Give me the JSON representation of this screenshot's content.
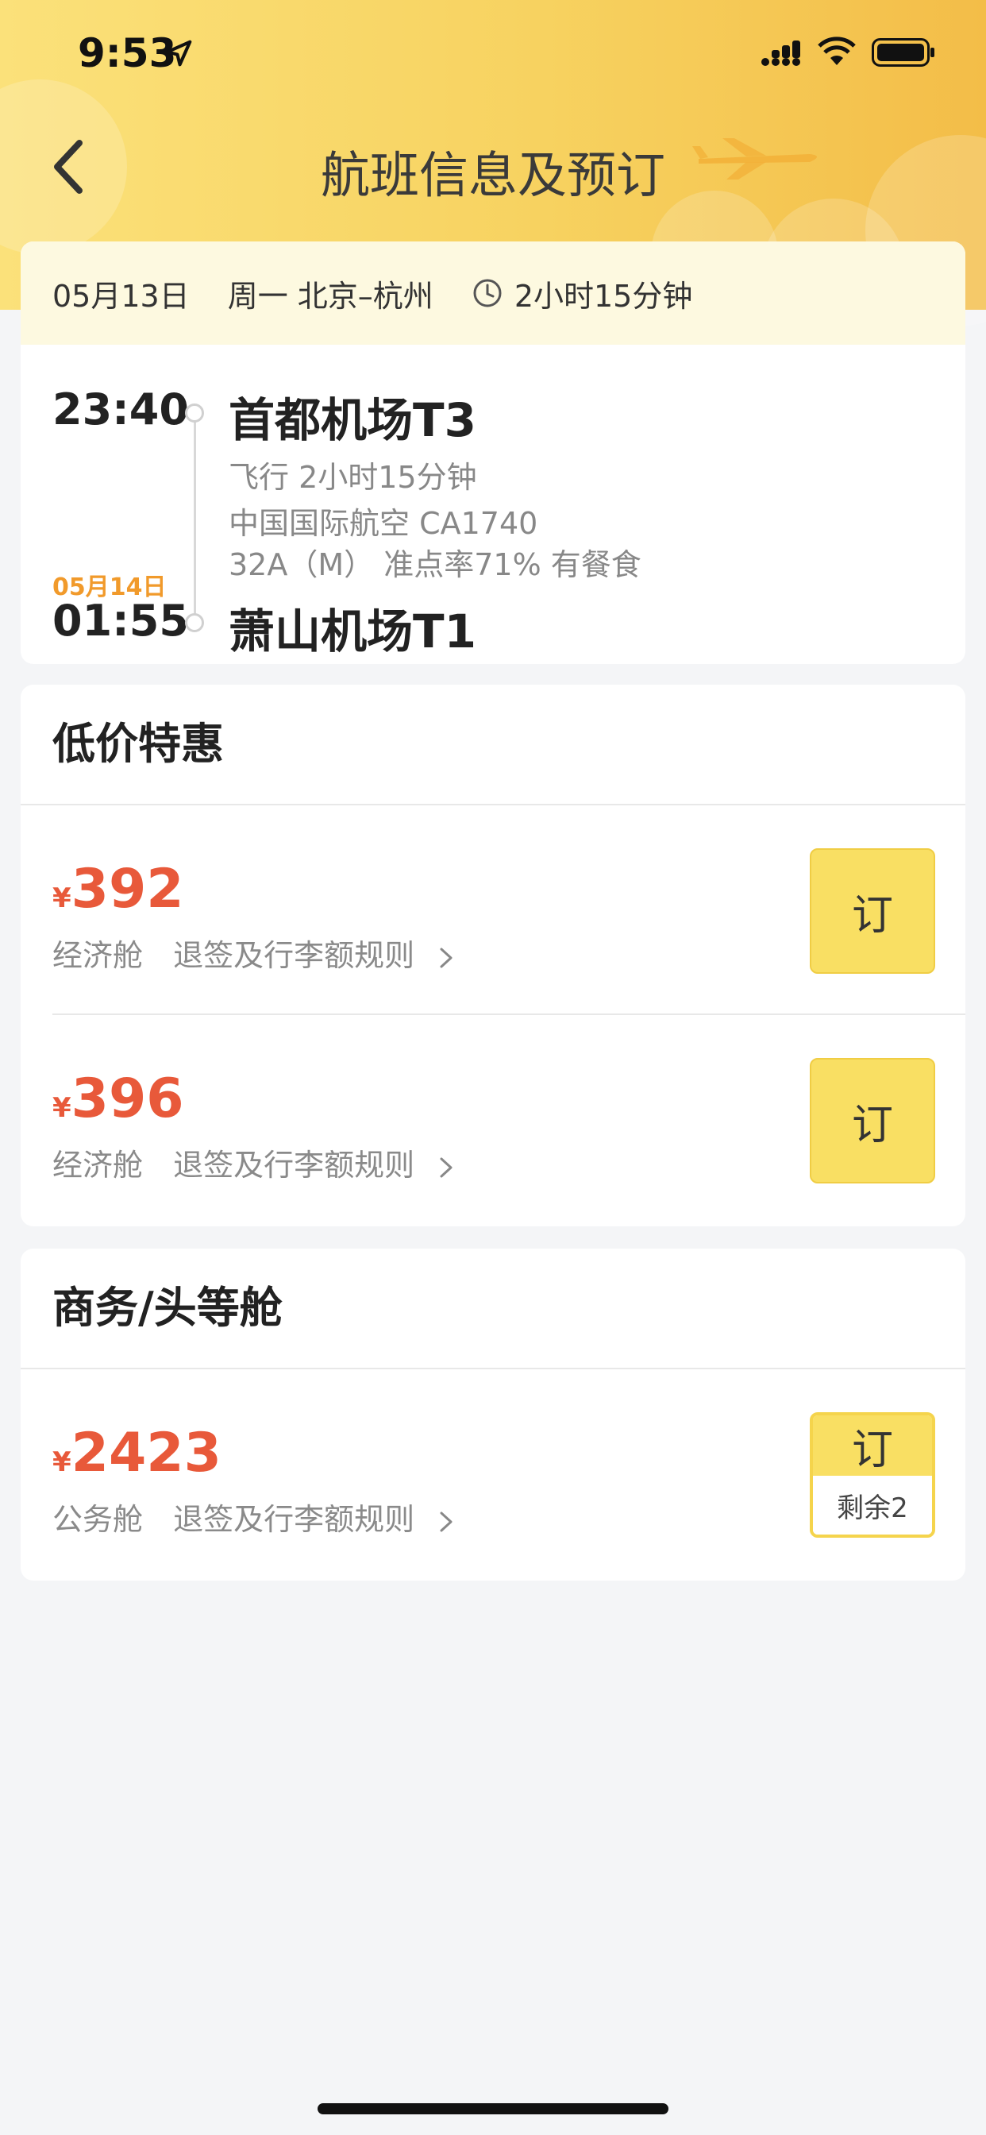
{
  "status_bar": {
    "time": "9:53",
    "icons": [
      "location-arrow-icon",
      "signal-icon",
      "wifi-icon",
      "battery-icon"
    ]
  },
  "nav": {
    "title": "航班信息及预订",
    "back_icon": "back-chevron-icon",
    "decor_icon": "airplane-icon"
  },
  "flight": {
    "date": "05月13日",
    "weekday_route": "周一 北京–杭州",
    "duration": "2小时15分钟",
    "departure": {
      "time": "23:40",
      "airport": "首都机场T3"
    },
    "arrival": {
      "date": "05月14日",
      "time": "01:55",
      "airport": "萧山机场T1"
    },
    "flight_time": "飞行 2小时15分钟",
    "airline": "中国国际航空 CA1740",
    "details": "32A（M） 准点率71% 有餐食"
  },
  "sections": [
    {
      "title": "低价特惠",
      "fares": [
        {
          "currency": "¥",
          "price": "392",
          "cabin": "经济舱",
          "rule": "退签及行李额规则",
          "button": "订"
        },
        {
          "currency": "¥",
          "price": "396",
          "cabin": "经济舱",
          "rule": "退签及行李额规则",
          "button": "订"
        }
      ]
    },
    {
      "title": "商务/头等舱",
      "fares": [
        {
          "currency": "¥",
          "price": "2423",
          "cabin": "公务舱",
          "rule": "退签及行李额规则",
          "button": "订",
          "remaining": "剩余2"
        }
      ]
    }
  ],
  "colors": {
    "header_yellow": "#f7d260",
    "price_red": "#e8593a",
    "button_yellow": "#f9df63",
    "arrival_date_orange": "#f19a2b"
  }
}
